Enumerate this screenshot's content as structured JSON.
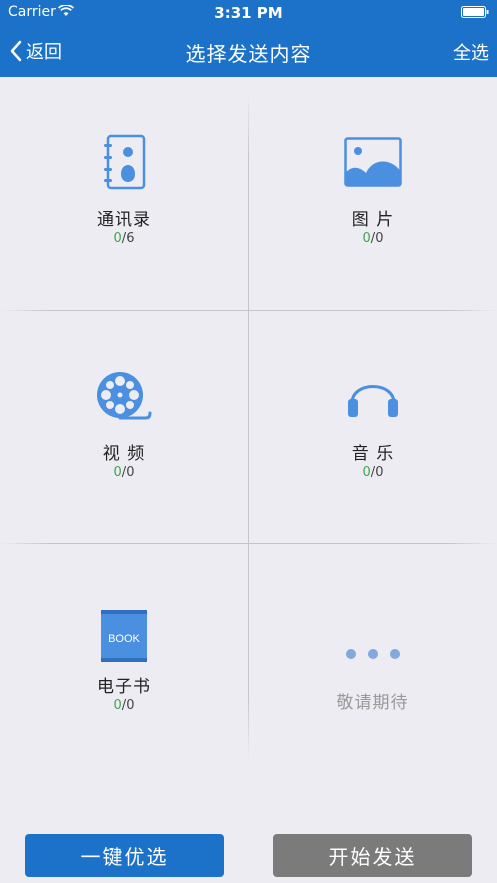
{
  "status_bar": {
    "carrier": "Carrier",
    "time": "3:31 PM"
  },
  "navbar": {
    "back_label": "返回",
    "title": "选择发送内容",
    "select_all_label": "全选"
  },
  "colors": {
    "brand": "#1c72c8",
    "icon": "#4a8fe0",
    "selected_count": "#3aa94a",
    "disabled_button": "#7b7b7b"
  },
  "categories": [
    {
      "label": "通讯录",
      "selected": "0",
      "sep": "/",
      "total": "6",
      "icon": "contacts-icon"
    },
    {
      "label": "图 片",
      "selected": "0",
      "sep": "/",
      "total": "0",
      "icon": "picture-icon"
    },
    {
      "label": "视 频",
      "selected": "0",
      "sep": "/",
      "total": "0",
      "icon": "film-reel-icon"
    },
    {
      "label": "音 乐",
      "selected": "0",
      "sep": "/",
      "total": "0",
      "icon": "headphones-icon"
    },
    {
      "label": "电子书",
      "selected": "0",
      "sep": "/",
      "total": "0",
      "icon": "book-icon",
      "icon_text": "BOOK"
    }
  ],
  "more": {
    "label": "敬请期待",
    "icon": "more-dots-icon"
  },
  "bottom": {
    "quick_select_label": "一键优选",
    "start_send_label": "开始发送"
  }
}
